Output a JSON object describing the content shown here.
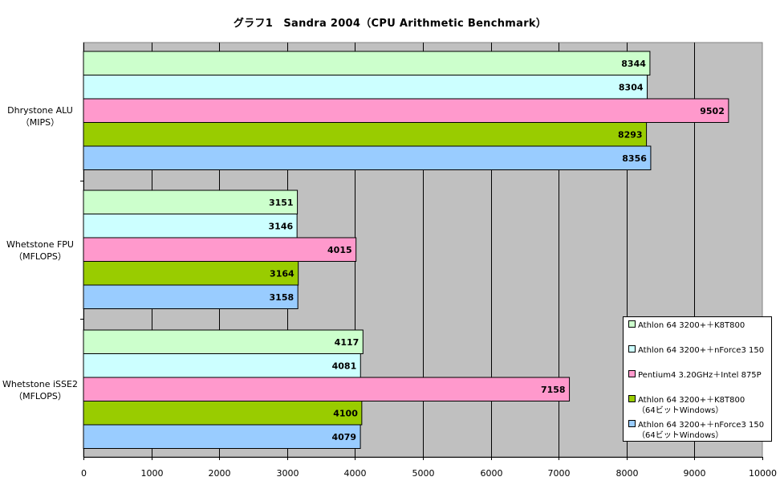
{
  "chart_data": {
    "type": "bar",
    "orientation": "horizontal",
    "title": "グラフ1　Sandra 2004（CPU Arithmetic Benchmark）",
    "categories": [
      {
        "line1": "Dhrystone ALU",
        "line2": "（MIPS）"
      },
      {
        "line1": "Whetstone FPU",
        "line2": "（MFLOPS）"
      },
      {
        "line1": "Whetstone iSSE2",
        "line2": "（MFLOPS）"
      }
    ],
    "series": [
      {
        "name": "Athlon 64 3200+＋K8T800",
        "name2": "",
        "color": "#ccffcc",
        "values": [
          8344,
          3151,
          4117
        ]
      },
      {
        "name": "Athlon 64 3200+＋nForce3 150",
        "name2": "",
        "color": "#ccffff",
        "values": [
          8304,
          3146,
          4081
        ]
      },
      {
        "name": "Pentium4 3.20GHz＋Intel 875P",
        "name2": "",
        "color": "#ff99cc",
        "values": [
          9502,
          4015,
          7158
        ]
      },
      {
        "name": "Athlon 64 3200+＋K8T800",
        "name2": "（64ビットWindows）",
        "color": "#99cc00",
        "values": [
          8293,
          3164,
          4100
        ]
      },
      {
        "name": "Athlon 64 3200+＋nForce3 150",
        "name2": "（64ビットWindows）",
        "color": "#99ccff",
        "values": [
          8356,
          3158,
          4079
        ]
      }
    ],
    "xlim": [
      0,
      10000
    ],
    "xticks": [
      "0",
      "1000",
      "2000",
      "3000",
      "4000",
      "5000",
      "6000",
      "7000",
      "8000",
      "9000",
      "10000"
    ],
    "grid": true,
    "plot_background": "#c0c0c0",
    "legend_position": "bottom-right"
  }
}
